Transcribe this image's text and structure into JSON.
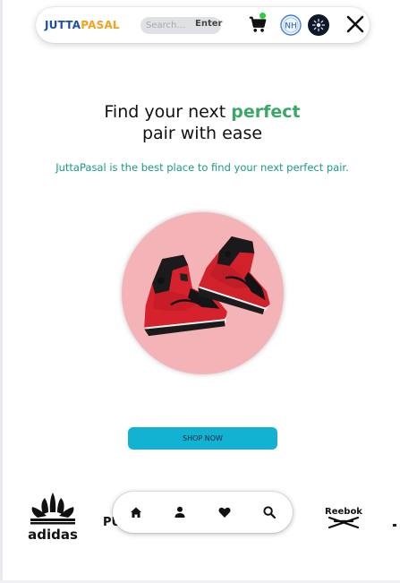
{
  "header": {
    "logo_part1": "JUTTA",
    "logo_part2": "PASAL",
    "search_placeholder": "Search...",
    "search_button": "Enter",
    "avatar_initials": "NH",
    "icons": [
      "cart-icon",
      "avatar-icon",
      "theme-toggle-icon",
      "close-icon"
    ]
  },
  "hero": {
    "headline_before": "Find your next ",
    "headline_accent": "perfect",
    "headline_after": "pair with ease",
    "subheadline": "JuttaPasal is the best place to find your next perfect pair.",
    "cta": "SHOP NOW",
    "image_alt": "red and black high-top sneakers"
  },
  "brands": {
    "adidas": "adidas",
    "puma": "PU",
    "reebok": "Reebok"
  },
  "bottom_nav": {
    "icons": [
      "home-icon",
      "user-icon",
      "heart-icon",
      "search-icon"
    ]
  },
  "colors": {
    "logo_blue": "#1f4fa0",
    "logo_orange": "#f4a21b",
    "accent_green": "#3aa866",
    "sub_teal": "#199a8a",
    "cta_cyan": "#14b2d2",
    "hero_pink": "#f4b3b6"
  }
}
